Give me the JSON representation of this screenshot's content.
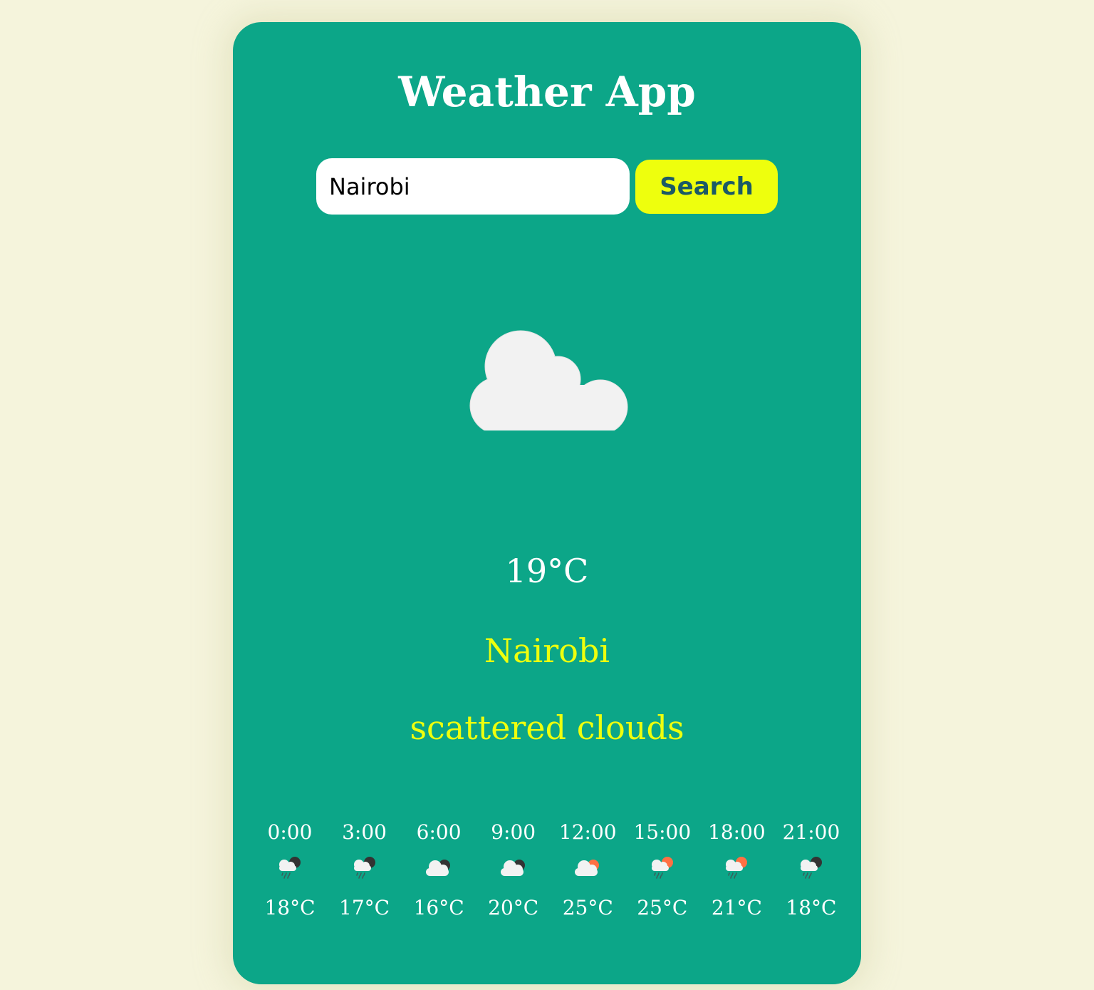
{
  "app": {
    "title": "Weather App"
  },
  "search": {
    "value": "Nairobi",
    "button_label": "Search"
  },
  "current": {
    "icon": "cloud-icon",
    "temperature": "19°C",
    "city": "Nairobi",
    "description": "scattered clouds"
  },
  "hourly": [
    {
      "time": "0:00",
      "icon": "rain-night-icon",
      "temp": "18°C"
    },
    {
      "time": "3:00",
      "icon": "rain-night-icon",
      "temp": "17°C"
    },
    {
      "time": "6:00",
      "icon": "cloudy-night-icon",
      "temp": "16°C"
    },
    {
      "time": "9:00",
      "icon": "cloudy-night-icon",
      "temp": "20°C"
    },
    {
      "time": "12:00",
      "icon": "cloudy-day-icon",
      "temp": "25°C"
    },
    {
      "time": "15:00",
      "icon": "rain-day-icon",
      "temp": "25°C"
    },
    {
      "time": "18:00",
      "icon": "rain-day-icon",
      "temp": "21°C"
    },
    {
      "time": "21:00",
      "icon": "rain-night-icon",
      "temp": "18°C"
    }
  ],
  "colors": {
    "background": "#f5f4dc",
    "card": "#0ca688",
    "accent_yellow": "#eeff0d",
    "button_text": "#1c5a66",
    "cloud": "#f2f2f2",
    "sun": "#ff7043",
    "moon": "#333333"
  }
}
